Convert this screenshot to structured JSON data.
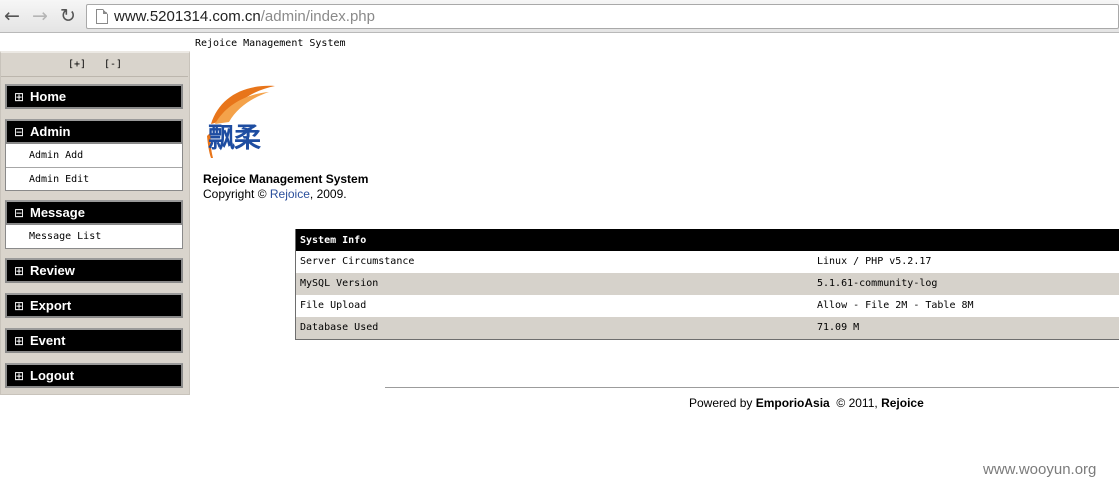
{
  "browser": {
    "url_host": "www.5201314.com.cn",
    "url_path": "/admin/index.php"
  },
  "page": {
    "top_title": "Rejoice Management System"
  },
  "sidebar": {
    "expand_all": "[+]",
    "collapse_all": "[-]",
    "menus": [
      {
        "sign": "⊞",
        "label": "Home"
      },
      {
        "sign": "⊟",
        "label": "Admin",
        "items": [
          "Admin Add",
          "Admin Edit"
        ]
      },
      {
        "sign": "⊟",
        "label": "Message",
        "items": [
          "Message List"
        ]
      },
      {
        "sign": "⊞",
        "label": "Review"
      },
      {
        "sign": "⊞",
        "label": "Export"
      },
      {
        "sign": "⊞",
        "label": "Event"
      },
      {
        "sign": "⊞",
        "label": "Logout"
      }
    ]
  },
  "brand": {
    "logo_text": "飘柔",
    "system_name": "Rejoice Management System",
    "copyright_prefix": "Copyright © ",
    "copyright_owner": "Rejoice",
    "copyright_suffix": ", 2009."
  },
  "system_info": {
    "title": "System Info",
    "rows": [
      {
        "label": "Server Circumstance",
        "value": "Linux / PHP v5.2.17"
      },
      {
        "label": "MySQL Version",
        "value": "5.1.61-community-log"
      },
      {
        "label": "File Upload",
        "value": "Allow - File 2M - Table 8M"
      },
      {
        "label": "Database Used",
        "value": "71.09 M"
      }
    ]
  },
  "footer": {
    "powered_by": "Powered by ",
    "company": "EmporioAsia",
    "year_text": "© 2011,",
    "brand": "Rejoice"
  },
  "watermark": "www.wooyun.org",
  "colors": {
    "logo_orange": "#e8751a",
    "logo_blue": "#1e4da1",
    "sidebar_bg": "#d9d4cc"
  }
}
